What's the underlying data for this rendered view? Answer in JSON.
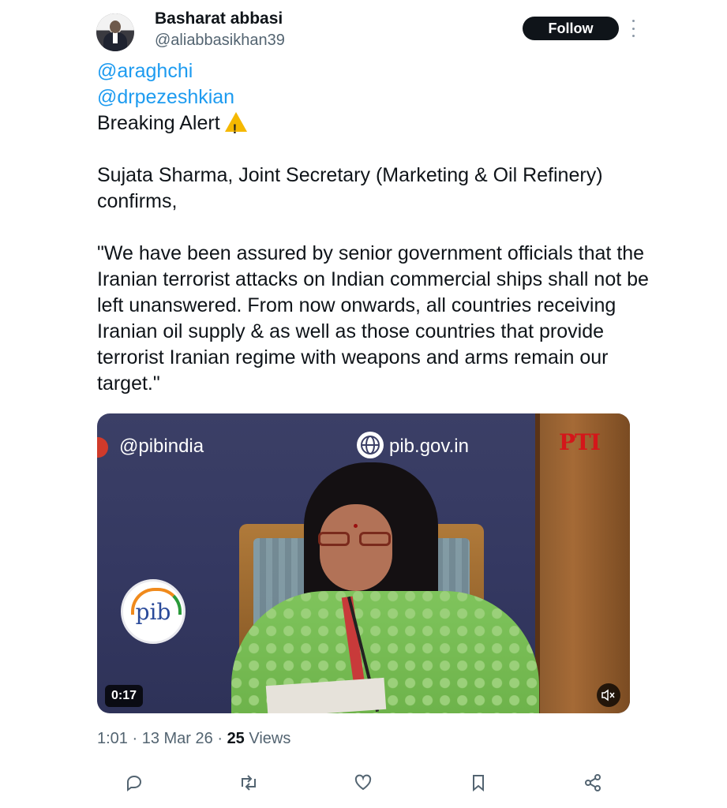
{
  "author": {
    "display_name": "Basharat abbasi",
    "handle": "@aliabbasikhan39"
  },
  "follow_label": "Follow",
  "tweet": {
    "mention_1": "@araghchi",
    "mention_2": "@drpezeshkian",
    "line_alert": "Breaking Alert",
    "alert_icon": "warning-icon",
    "para_1": "Sujata Sharma, Joint Secretary (Marketing & Oil Refinery) confirms,",
    "para_2": "\"We have been assured by senior government officials that the Iranian terrorist attacks on Indian commercial ships shall not be left unanswered. From now onwards, all countries receiving Iranian oil supply & as well as those countries that provide terrorist Iranian regime with weapons and arms remain our target.\""
  },
  "video": {
    "overlay_handle": "@pibindia",
    "overlay_url": "pib.gov.in",
    "logo_text": "pib",
    "corner_logo": "PTI",
    "duration": "0:17",
    "mute_icon": "muted-speaker-icon"
  },
  "meta": {
    "time": "1:01",
    "date": "13 Mar 26",
    "views_count": "25",
    "views_label": "Views"
  },
  "actions": [
    "reply-icon",
    "retweet-icon",
    "like-icon",
    "bookmark-icon",
    "share-icon"
  ],
  "colors": {
    "link": "#1d9bf0",
    "text": "#0f1419",
    "secondary": "#536471",
    "follow_bg": "#0f1419"
  }
}
